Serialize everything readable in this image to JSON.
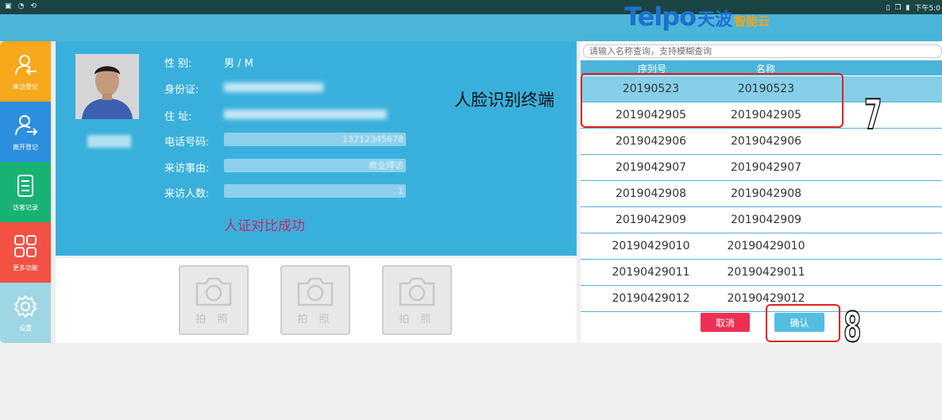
{
  "status_bar": {
    "time": "下午5:0"
  },
  "brand": {
    "logo_en": "Telpo",
    "logo_cn": "天波",
    "logo_sub": "智能云"
  },
  "sidebar": {
    "items": [
      {
        "label": "来访登记",
        "icon": "visitor-register-icon",
        "color": "#f7a81b"
      },
      {
        "label": "离开登记",
        "icon": "visitor-leave-icon",
        "color": "#2d8fe0"
      },
      {
        "label": "访客记录",
        "icon": "record-icon",
        "color": "#18b374"
      },
      {
        "label": "更多功能",
        "icon": "grid-icon",
        "color": "#f25144"
      },
      {
        "label": "设置",
        "icon": "gear-icon",
        "color": "#9fd6e4"
      }
    ]
  },
  "visitor": {
    "gender_label": "性 别:",
    "gender_value": "男 / M",
    "id_label": "身份证:",
    "address_label": "住 址:",
    "phone_label": "电话号码:",
    "phone_value": "13712345678",
    "reason_label": "来访事由:",
    "reason_value": "商业拜访",
    "count_label": "来访人数:",
    "count_value": "1",
    "compare_result": "人证对比成功"
  },
  "photo_buttons": [
    {
      "label": "拍 照"
    },
    {
      "label": "拍 照"
    },
    {
      "label": "拍 照"
    }
  ],
  "device_list": {
    "search_placeholder": "请输入名称查询，支持模糊查询",
    "columns": [
      "序列号",
      "名称"
    ],
    "rows": [
      {
        "serial": "20190523",
        "name": "20190523",
        "selected": true
      },
      {
        "serial": "2019042905",
        "name": "2019042905",
        "selected": false
      },
      {
        "serial": "2019042906",
        "name": "2019042906",
        "selected": false
      },
      {
        "serial": "2019042907",
        "name": "2019042907",
        "selected": false
      },
      {
        "serial": "2019042908",
        "name": "2019042908",
        "selected": false
      },
      {
        "serial": "2019042909",
        "name": "2019042909",
        "selected": false
      },
      {
        "serial": "20190429010",
        "name": "20190429010",
        "selected": false
      },
      {
        "serial": "20190429011",
        "name": "20190429011",
        "selected": false
      },
      {
        "serial": "20190429012",
        "name": "20190429012",
        "selected": false
      }
    ],
    "cancel_label": "取消",
    "confirm_label": "确认"
  },
  "annotations": {
    "label": "人脸识别终端",
    "step_7": "7",
    "step_8": "8"
  },
  "colors": {
    "panel_blue": "#39b0dc",
    "header_blue": "#4bb5d9",
    "selected_row": "#86cfe9",
    "cancel_red": "#ee2f54",
    "confirm_blue": "#53bde3",
    "success_text": "#c8266a",
    "callout_red": "#e02020"
  }
}
